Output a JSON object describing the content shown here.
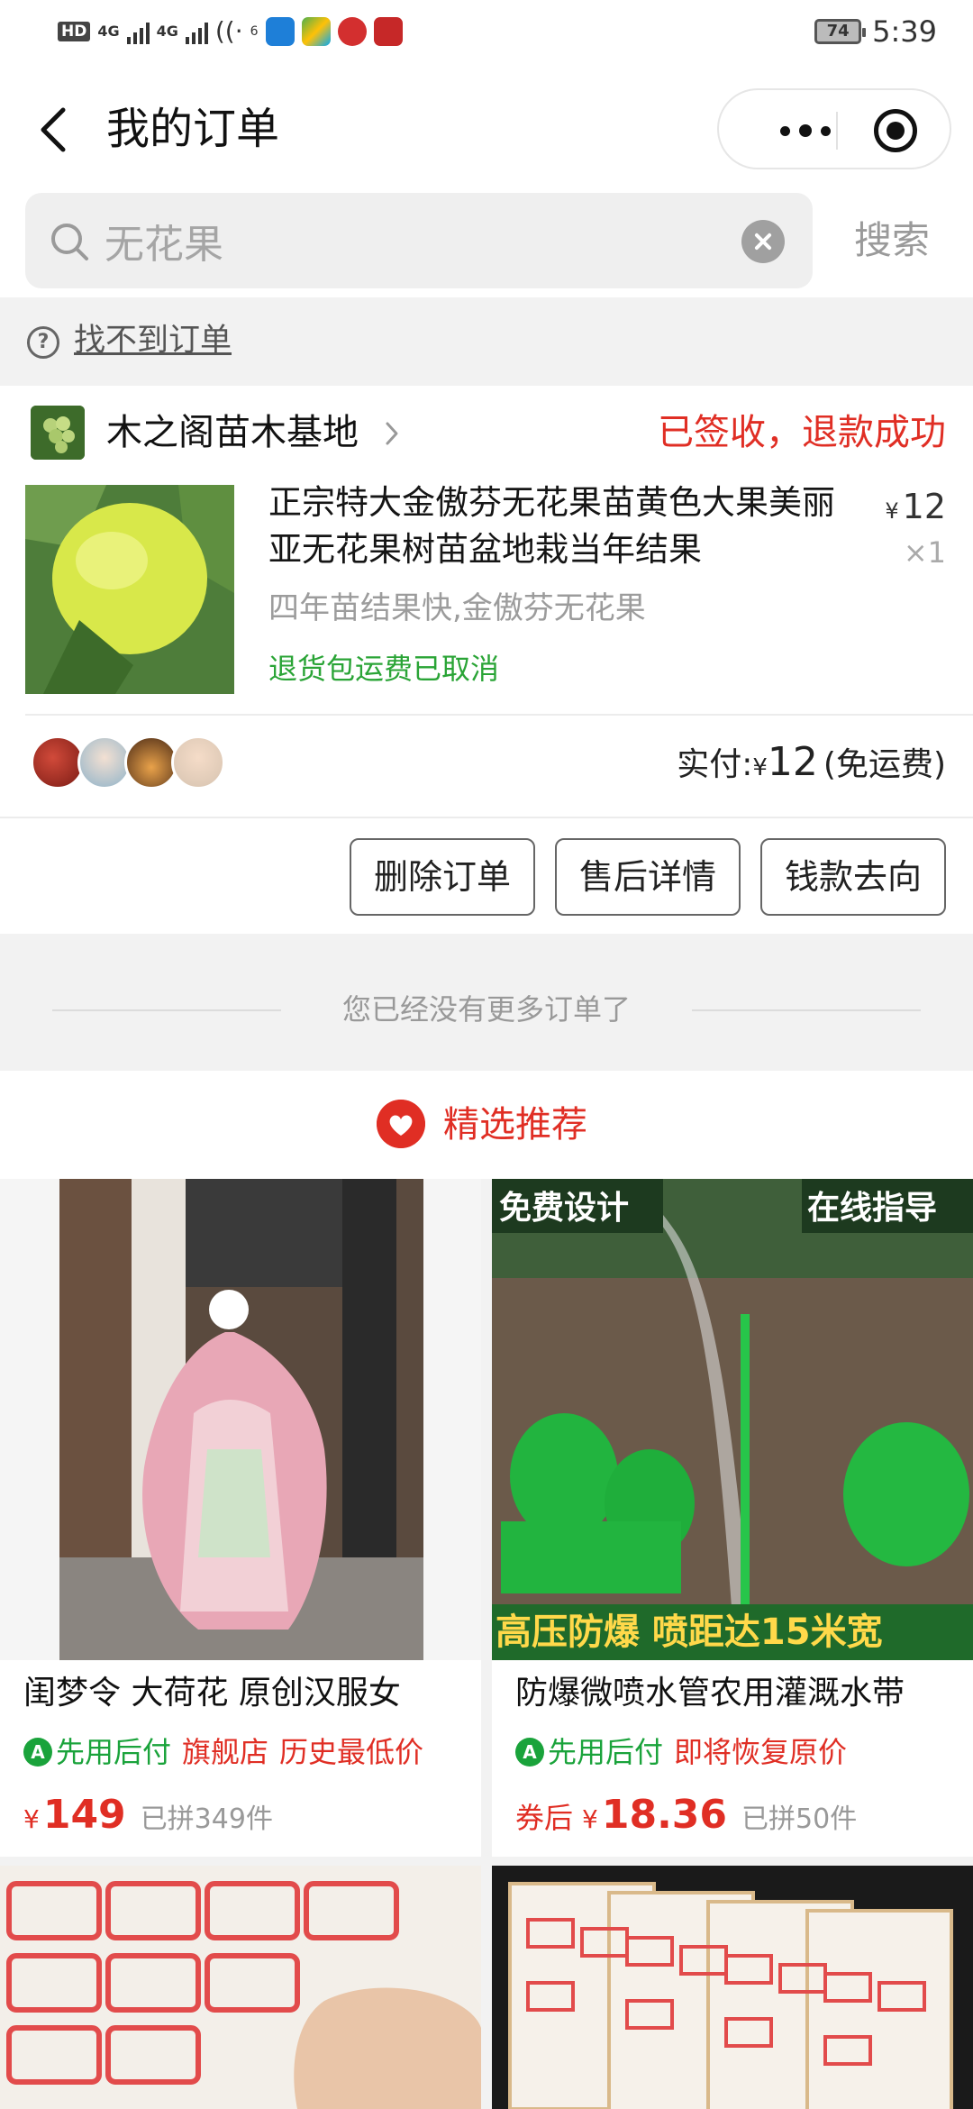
{
  "status_bar": {
    "network_hd": "HD",
    "net1": "4G",
    "net2": "4G",
    "wifi_sup": "6",
    "battery": "74",
    "time": "5:39"
  },
  "nav": {
    "title": "我的订单"
  },
  "search": {
    "value": "无花果",
    "button": "搜索"
  },
  "help": {
    "link": "找不到订单"
  },
  "order": {
    "shop_name": "木之阁苗木基地",
    "status": "已签收，退款成功",
    "title": "正宗特大金傲芬无花果苗黄色大果美丽亚无花果树苗盆地栽当年结果",
    "price_symbol": "¥",
    "price": "12",
    "qty": "×1",
    "spec": "四年苗结果快,金傲芬无花果",
    "note": "退货包运费已取消",
    "paid_label": "实付:",
    "paid_symbol": "¥",
    "paid_amount": "12",
    "paid_suffix": "(免运费)",
    "buttons": {
      "delete": "删除订单",
      "after_sale": "售后详情",
      "money": "钱款去向"
    }
  },
  "no_more": "您已经没有更多订单了",
  "recommend": {
    "title": "精选推荐"
  },
  "products": [
    {
      "title": "闺梦令 大荷花 原创汉服女",
      "pay_tag": "先用后付",
      "tag1": "旗舰店",
      "tag2": "历史最低价",
      "prefix": "",
      "currency": "¥",
      "price": "149",
      "sold": "已拼349件"
    },
    {
      "title": "防爆微喷水管农用灌溉水带",
      "pay_tag": "先用后付",
      "tag1": "即将恢复原价",
      "tag2": "",
      "prefix": "券后",
      "currency": "¥",
      "price": "18.36",
      "sold": "已拼50件",
      "banner_top_left": "免费设计",
      "banner_top_right": "在线指导",
      "banner_bottom": "高压防爆 喷距达15米宽"
    }
  ],
  "colors": {
    "accent_red": "#e02e24",
    "green": "#1aa33b",
    "gray_bg": "#f2f2f2"
  }
}
